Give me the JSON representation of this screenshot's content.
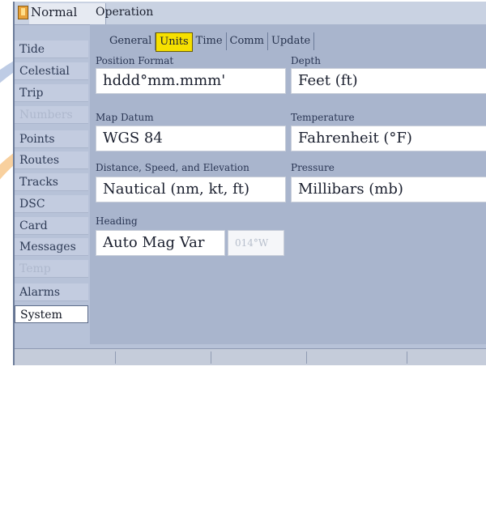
{
  "header": {
    "mode": "Normal",
    "subtitle": "Operation"
  },
  "sidebar": {
    "items": [
      {
        "label": "Tide",
        "state": "normal"
      },
      {
        "label": "Celestial",
        "state": "normal"
      },
      {
        "label": "Trip",
        "state": "normal"
      },
      {
        "label": "Numbers",
        "state": "dim"
      },
      {
        "label": "Points",
        "state": "normal"
      },
      {
        "label": "Routes",
        "state": "normal"
      },
      {
        "label": "Tracks",
        "state": "normal"
      },
      {
        "label": "DSC",
        "state": "normal"
      },
      {
        "label": "Card",
        "state": "normal"
      },
      {
        "label": "Messages",
        "state": "normal"
      },
      {
        "label": "Temp",
        "state": "dim"
      },
      {
        "label": "Alarms",
        "state": "normal"
      },
      {
        "label": "System",
        "state": "selected"
      }
    ]
  },
  "tabs": [
    {
      "label": "General",
      "active": false
    },
    {
      "label": "Units",
      "active": true
    },
    {
      "label": "Time",
      "active": false
    },
    {
      "label": "Comm",
      "active": false
    },
    {
      "label": "Update",
      "active": false
    }
  ],
  "settings": {
    "position_format": {
      "label": "Position Format",
      "value": "hddd°mm.mmm'"
    },
    "depth": {
      "label": "Depth",
      "value": "Feet (ft)"
    },
    "map_datum": {
      "label": "Map Datum",
      "value": "WGS 84"
    },
    "temperature": {
      "label": "Temperature",
      "value": "Fahrenheit (°F)"
    },
    "distance_speed_elevation": {
      "label": "Distance, Speed, and Elevation",
      "value": "Nautical (nm, kt, ft)"
    },
    "pressure": {
      "label": "Pressure",
      "value": "Millibars (mb)"
    },
    "heading": {
      "label": "Heading",
      "value": "Auto Mag Var",
      "variation": "014°W"
    }
  },
  "colors": {
    "panel": "#a9b5cd",
    "active_tab": "#f6e000",
    "field": "#ffffff"
  }
}
